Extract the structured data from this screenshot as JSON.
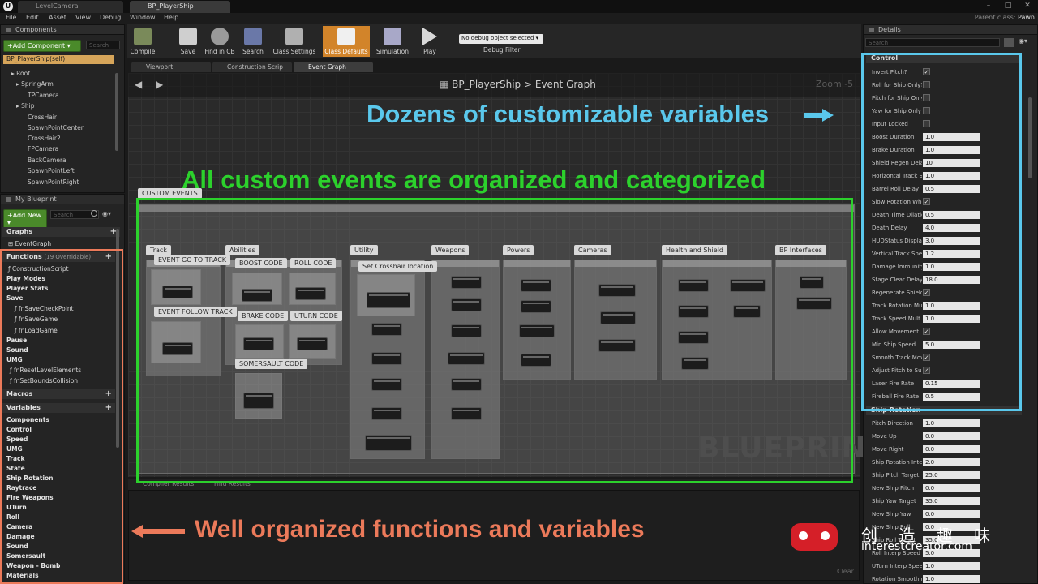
{
  "window": {
    "tabs": [
      "LevelCamera",
      "BP_PlayerShip"
    ],
    "parent_class_label": "Parent class:",
    "parent_class_value": "Pawn"
  },
  "menu": [
    "File",
    "Edit",
    "Asset",
    "View",
    "Debug",
    "Window",
    "Help"
  ],
  "components": {
    "title": "Components",
    "add_button": "+Add Component ▾",
    "search_placeholder": "Search",
    "self": "BP_PlayerShip(self)",
    "tree": [
      "Root",
      "SpringArm",
      "TPCamera",
      "Ship",
      "CrossHair",
      "SpawnPointCenter",
      "CrossHair2",
      "FPCamera",
      "BackCamera",
      "SpawnPointLeft",
      "SpawnPointRight"
    ]
  },
  "my_blueprint": {
    "title": "My Blueprint",
    "add_button": "+Add New ▾",
    "search_placeholder": "Search",
    "graphs_header": "Graphs",
    "event_graph": "EventGraph",
    "functions_header": "Functions",
    "functions_count": "(19 Overridable)",
    "functions": [
      "ConstructionScript",
      "Play Modes",
      "Player Stats",
      "Save",
      "fnSaveCheckPoint",
      "fnSaveGame",
      "fnLoadGame",
      "Pause",
      "Sound",
      "UMG",
      "fnResetLevelElements",
      "fnSetBoundsCollision"
    ],
    "macros_header": "Macros",
    "variables_header": "Variables",
    "variables": [
      "Components",
      "Control",
      "Speed",
      "UMG",
      "Track",
      "State",
      "Ship Rotation",
      "Raytrace",
      "Fire Weapons",
      "UTurn",
      "Roll",
      "Camera",
      "Damage",
      "Sound",
      "Somersault",
      "Weapon - Bomb",
      "Materials"
    ]
  },
  "toolbar": {
    "compile": "Compile",
    "save": "Save",
    "find_in_cb": "Find in CB",
    "search": "Search",
    "class_settings": "Class Settings",
    "class_defaults": "Class Defaults",
    "simulation": "Simulation",
    "play": "Play",
    "debug_object": "No debug object selected ▾",
    "debug_filter": "Debug Filter"
  },
  "graph_tabs": [
    "Viewport",
    "Construction Scrip",
    "Event Graph"
  ],
  "graph": {
    "breadcrumb_bp": "BP_PlayerShip",
    "breadcrumb_sep": ">",
    "breadcrumb_graph": "Event Graph",
    "zoom": "Zoom -5",
    "watermark": "BLUEPRINT",
    "custom_events_label": "CUSTOM EVENTS",
    "groups": [
      "Track",
      "Abilities",
      "Utility",
      "Weapons",
      "Powers",
      "Cameras",
      "Health and Shield",
      "BP Interfaces"
    ],
    "labels": [
      "EVENT GO TO TRACK",
      "EVENT FOLLOW TRACK",
      "BOOST CODE",
      "ROLL CODE",
      "BRAKE CODE",
      "UTURN CODE",
      "SOMERSAULT CODE",
      "Set Crosshair location"
    ]
  },
  "bottom": {
    "tabs": [
      "Compiler Results",
      "Find Results"
    ],
    "clear": "Clear"
  },
  "details": {
    "title": "Details",
    "search_placeholder": "Search",
    "control_header": "Control",
    "ship_rotation_header": "Ship Rotation",
    "rows": [
      {
        "label": "Invert Pitch?",
        "check": true
      },
      {
        "label": "Roll for Ship Only?",
        "check": false
      },
      {
        "label": "Pitch for Ship Only",
        "check": false
      },
      {
        "label": "Yaw for Ship Only",
        "check": false
      },
      {
        "label": "Input Locked",
        "check": false
      },
      {
        "label": "Boost Duration",
        "value": "1.0"
      },
      {
        "label": "Brake Duration",
        "value": "1.0"
      },
      {
        "label": "Shield Regen Delay",
        "value": "10"
      },
      {
        "label": "Horizontal Track Speed",
        "value": "1.0"
      },
      {
        "label": "Barrel Roll Delay",
        "value": "0.5"
      },
      {
        "label": "Slow Rotation When",
        "check": true
      },
      {
        "label": "Death Time Dilation",
        "value": "0.5"
      },
      {
        "label": "Death Delay",
        "value": "4.0"
      },
      {
        "label": "HUDStatus Display",
        "value": "3.0"
      },
      {
        "label": "Vertical Track Speed",
        "value": "1.2"
      },
      {
        "label": "Damage Immunity",
        "value": "1.0"
      },
      {
        "label": "Stage Clear Delay",
        "value": "18.0"
      },
      {
        "label": "Regenerate Shield",
        "check": true
      },
      {
        "label": "Track Rotation Mult",
        "value": "1.0"
      },
      {
        "label": "Track Speed Mult",
        "value": "1.0"
      },
      {
        "label": "Allow Movement",
        "check": true
      },
      {
        "label": "Min Ship Speed",
        "value": "5.0"
      },
      {
        "label": "Smooth Track Move",
        "check": true
      },
      {
        "label": "Adjust Pitch to Su",
        "check": true
      },
      {
        "label": "Laser Fire Rate",
        "value": "0.15"
      },
      {
        "label": "Fireball Fire Rate",
        "value": "0.5"
      }
    ],
    "rows2": [
      {
        "label": "Pitch Direction",
        "value": "1.0"
      },
      {
        "label": "Move Up",
        "value": "0.0"
      },
      {
        "label": "Move Right",
        "value": "0.0"
      },
      {
        "label": "Ship Rotation Interp",
        "value": "2.0"
      },
      {
        "label": "Ship Pitch Target",
        "value": "25.0"
      },
      {
        "label": "New Ship Pitch",
        "value": "0.0"
      },
      {
        "label": "Ship Yaw Target",
        "value": "35.0"
      },
      {
        "label": "New Ship Yaw",
        "value": "0.0"
      },
      {
        "label": "New Ship Roll",
        "value": "0.0"
      },
      {
        "label": "Ship Roll Target",
        "value": "35.0"
      },
      {
        "label": "Roll Interp Speed",
        "value": "5.0"
      },
      {
        "label": "UTurn Interp Speed",
        "value": "1.0"
      },
      {
        "label": "Rotation Smoothing",
        "value": "1.0"
      }
    ]
  },
  "annotations": {
    "green": "All custom events are organized and categorized",
    "blue": "Dozens of customizable variables",
    "orange": "Well organized functions and variables"
  },
  "watermark": {
    "cn": "创 造 趣 味",
    "en": "interestcreator.com"
  }
}
